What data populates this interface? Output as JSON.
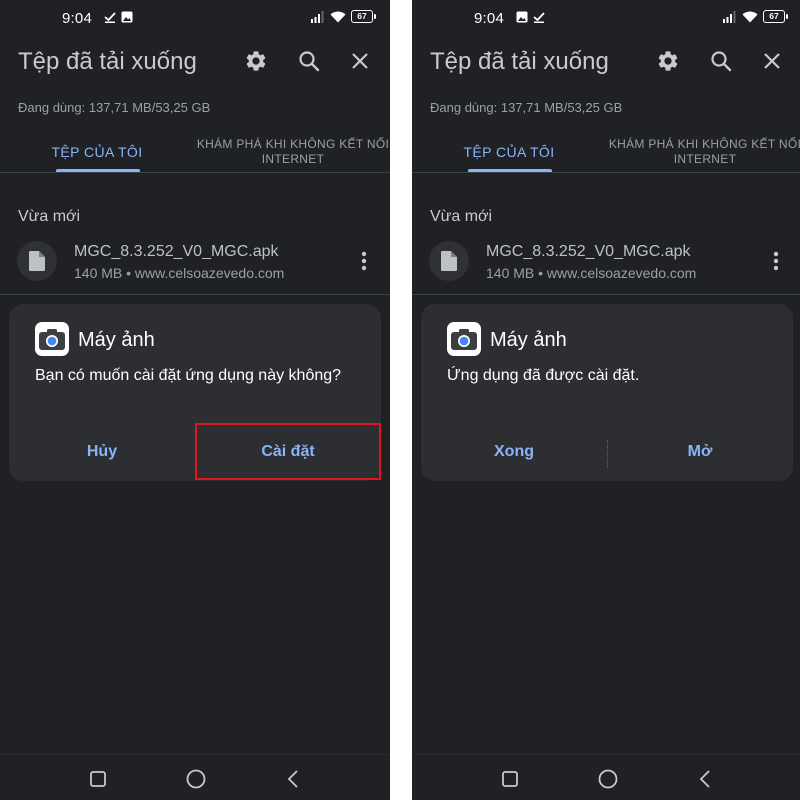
{
  "screens": [
    {
      "status": {
        "time": "9:04",
        "battery": "67"
      },
      "app_bar": {
        "title": "Tệp đã tải xuống"
      },
      "storage": "Đang dùng: 137,71 MB/53,25 GB",
      "tabs": [
        "TỆP CỦA TÔI",
        "KHÁM PHÁ KHI KHÔNG KẾT NỐI INTERNET"
      ],
      "section": "Vừa mới",
      "file": {
        "name": "MGC_8.3.252_V0_MGC.apk",
        "meta": "140 MB • www.celsoazevedo.com"
      },
      "dialog": {
        "title": "Máy ảnh",
        "message": "Bạn có muốn cài đặt ứng dụng này không?",
        "left_button": "Hủy",
        "right_button": "Cài đặt"
      }
    },
    {
      "status": {
        "time": "9:04",
        "battery": "67"
      },
      "app_bar": {
        "title": "Tệp đã tải xuống"
      },
      "storage": "Đang dùng: 137,71 MB/53,25 GB",
      "tabs": [
        "TỆP CỦA TÔI",
        "KHÁM PHÁ KHI KHÔNG KẾT NỐI INTERNET"
      ],
      "section": "Vừa mới",
      "file": {
        "name": "MGC_8.3.252_V0_MGC.apk",
        "meta": "140 MB • www.celsoazevedo.com"
      },
      "dialog": {
        "title": "Máy ảnh",
        "message": "Ứng dụng đã được cài đặt.",
        "left_button": "Xong",
        "right_button": "Mở"
      }
    }
  ],
  "icons": {
    "status_left": [
      "download-done-icon",
      "image-icon"
    ],
    "status_right": [
      "signal-icon",
      "wifi-icon",
      "battery-icon"
    ],
    "app_bar": [
      "gear-icon",
      "search-icon",
      "close-icon"
    ],
    "file": "file-icon",
    "overflow": "more-vert-icon",
    "dialog_app": "camera-app-icon",
    "nav": [
      "recents-icon",
      "home-icon",
      "back-icon"
    ]
  },
  "colors": {
    "background": "#202124",
    "accent": "#8ab4f8",
    "dialog": "#2d2e31",
    "highlight": "#e0161d"
  }
}
